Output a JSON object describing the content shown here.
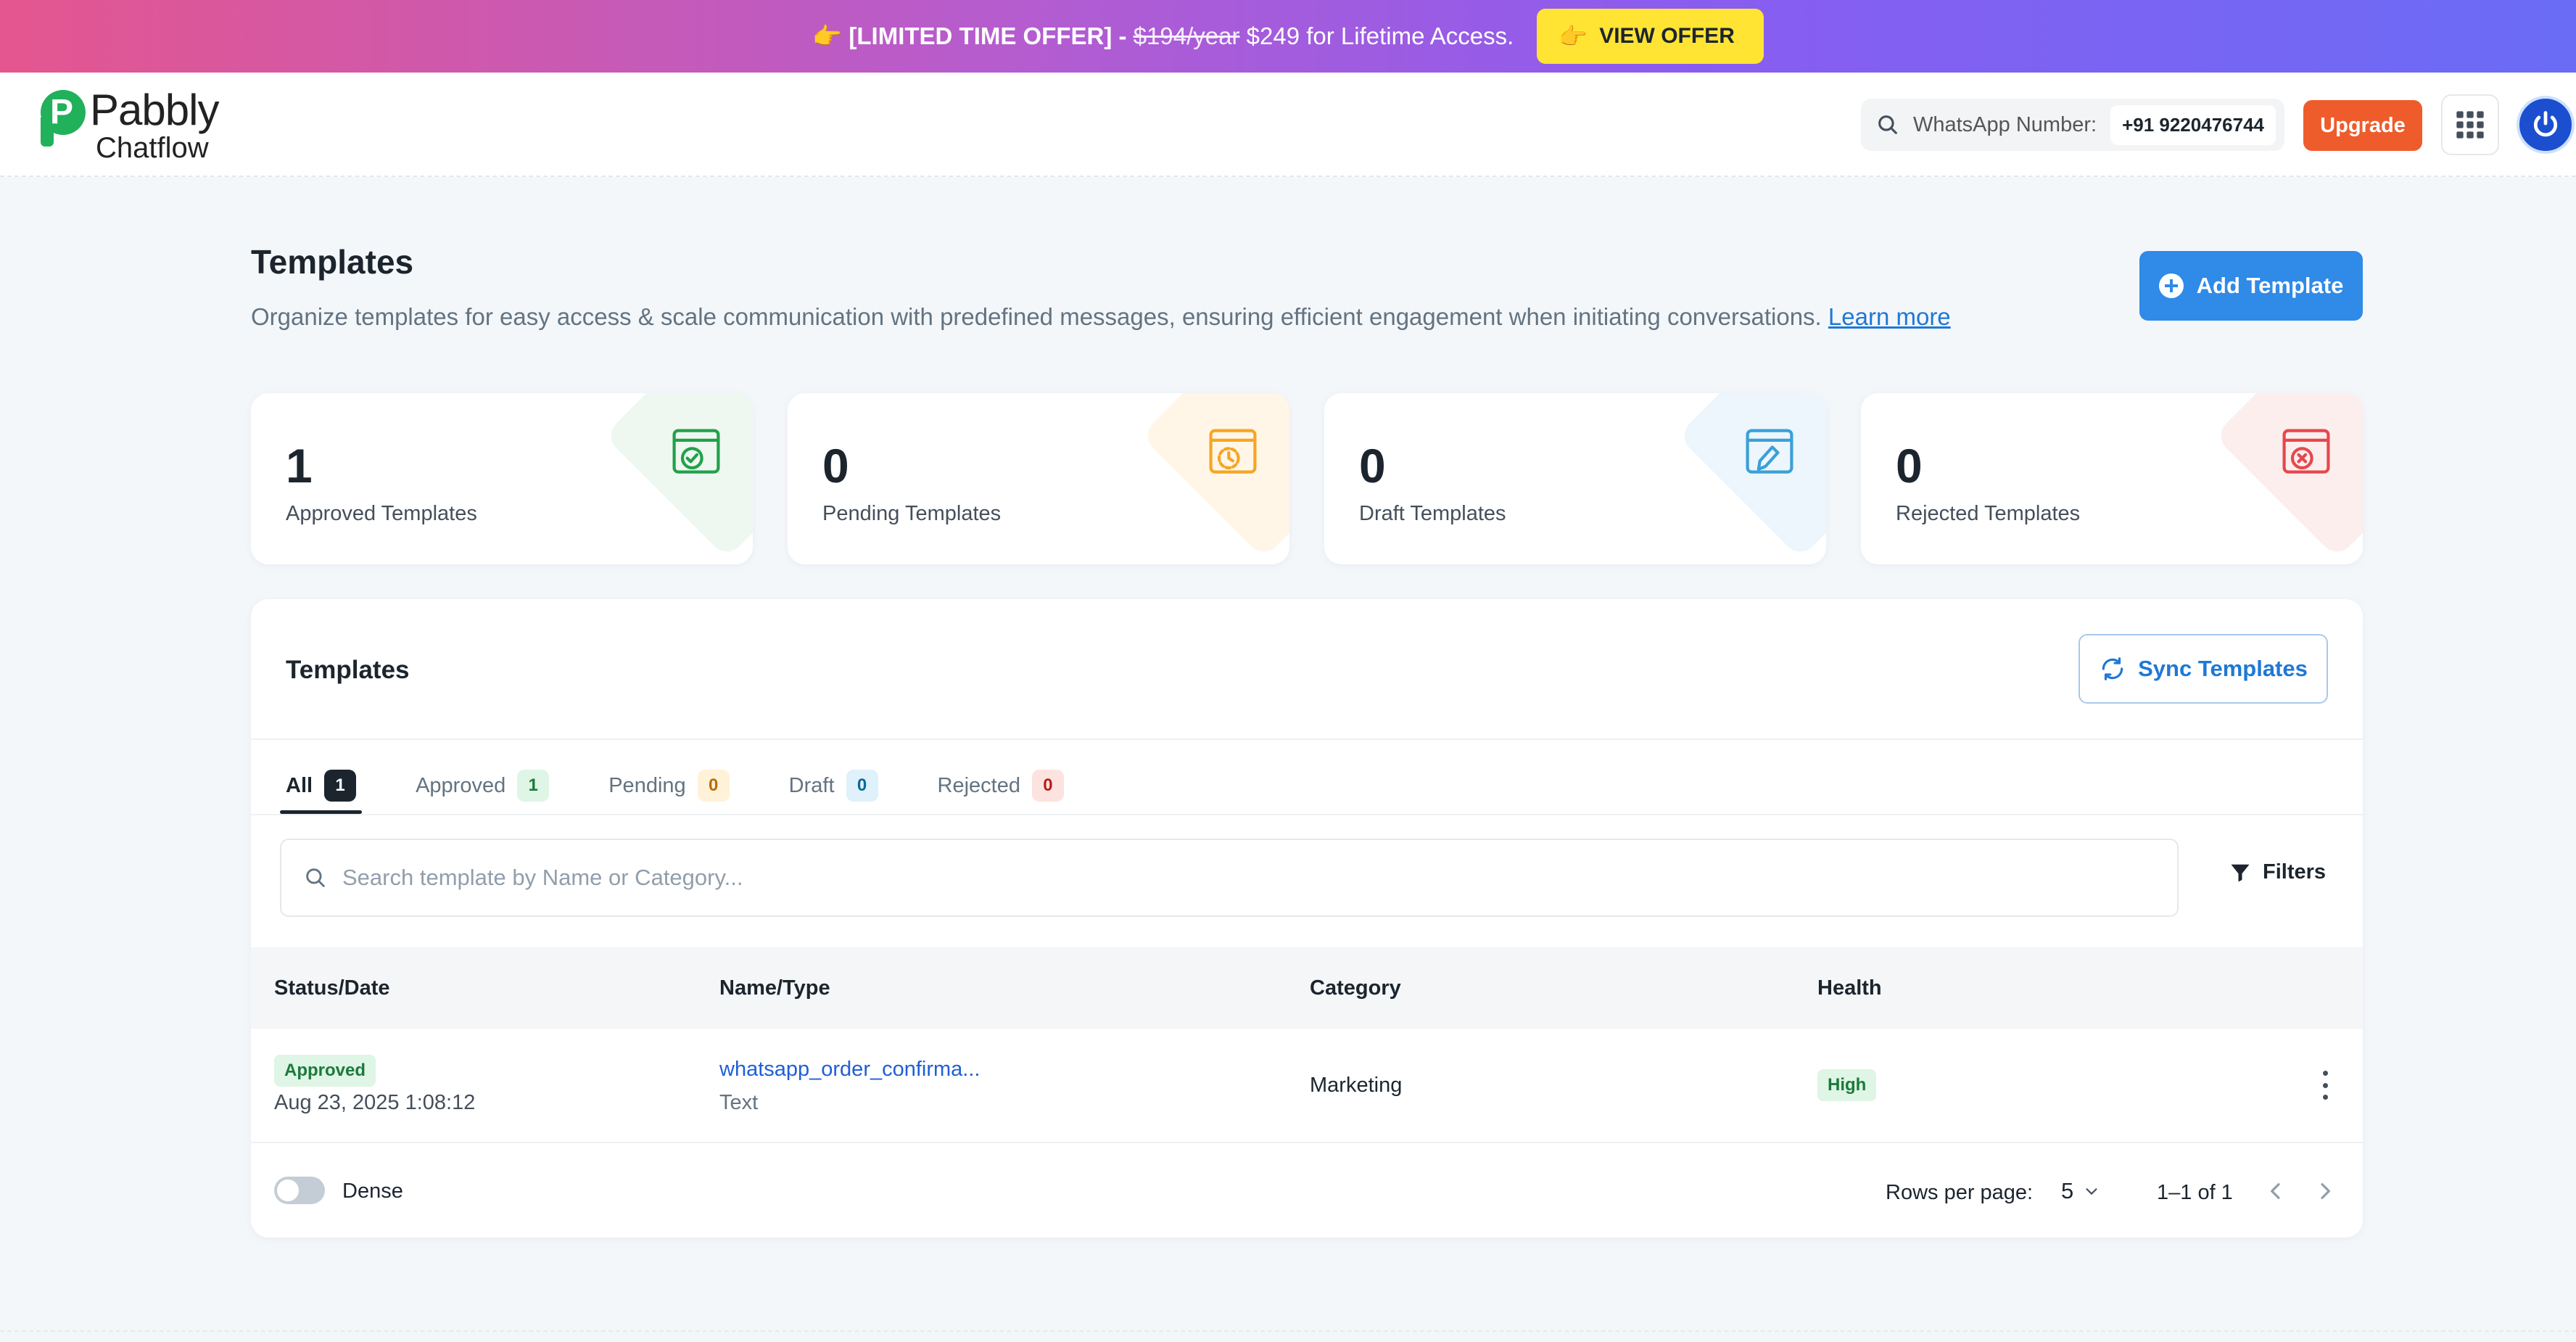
{
  "promo": {
    "hand_icon": "👉",
    "prefix": "[LIMITED TIME OFFER] -",
    "old_price": "$194/year",
    "rest": "$249 for Lifetime Access.",
    "button_label": "VIEW OFFER",
    "button_icon": "👉"
  },
  "header": {
    "logo_line1": "Pabbly",
    "logo_line2": "Chatflow",
    "whatsapp_label": "WhatsApp Number:",
    "whatsapp_number": "+91 9220476744",
    "upgrade_label": "Upgrade"
  },
  "page": {
    "title": "Templates",
    "description": "Organize templates for easy access & scale communication with predefined messages, ensuring efficient engagement when initiating conversations.",
    "learn_more": "Learn more",
    "add_button": "Add Template"
  },
  "stats": [
    {
      "value": "1",
      "label": "Approved Templates",
      "color": "#22a04b",
      "tint": "#eef8f0"
    },
    {
      "value": "0",
      "label": "Pending Templates",
      "color": "#f5a623",
      "tint": "#fff6e8"
    },
    {
      "value": "0",
      "label": "Draft Templates",
      "color": "#3aa0d8",
      "tint": "#ecf6fc"
    },
    {
      "value": "0",
      "label": "Rejected Templates",
      "color": "#e5484d",
      "tint": "#fdeeee"
    }
  ],
  "table": {
    "title": "Templates",
    "sync_button": "Sync Templates",
    "tabs": [
      {
        "label": "All",
        "count": "1"
      },
      {
        "label": "Approved",
        "count": "1"
      },
      {
        "label": "Pending",
        "count": "0"
      },
      {
        "label": "Draft",
        "count": "0"
      },
      {
        "label": "Rejected",
        "count": "0"
      }
    ],
    "search_placeholder": "Search template by Name or Category...",
    "filters_label": "Filters",
    "columns": [
      "Status/Date",
      "Name/Type",
      "Category",
      "Health"
    ],
    "rows": [
      {
        "status": "Approved",
        "date": "Aug 23, 2025 1:08:12",
        "name": "whatsapp_order_confirma...",
        "type": "Text",
        "category": "Marketing",
        "health": "High"
      }
    ],
    "footer": {
      "dense_label": "Dense",
      "rows_per_page_label": "Rows per page:",
      "rows_per_page_value": "5",
      "range": "1–1 of 1"
    }
  }
}
